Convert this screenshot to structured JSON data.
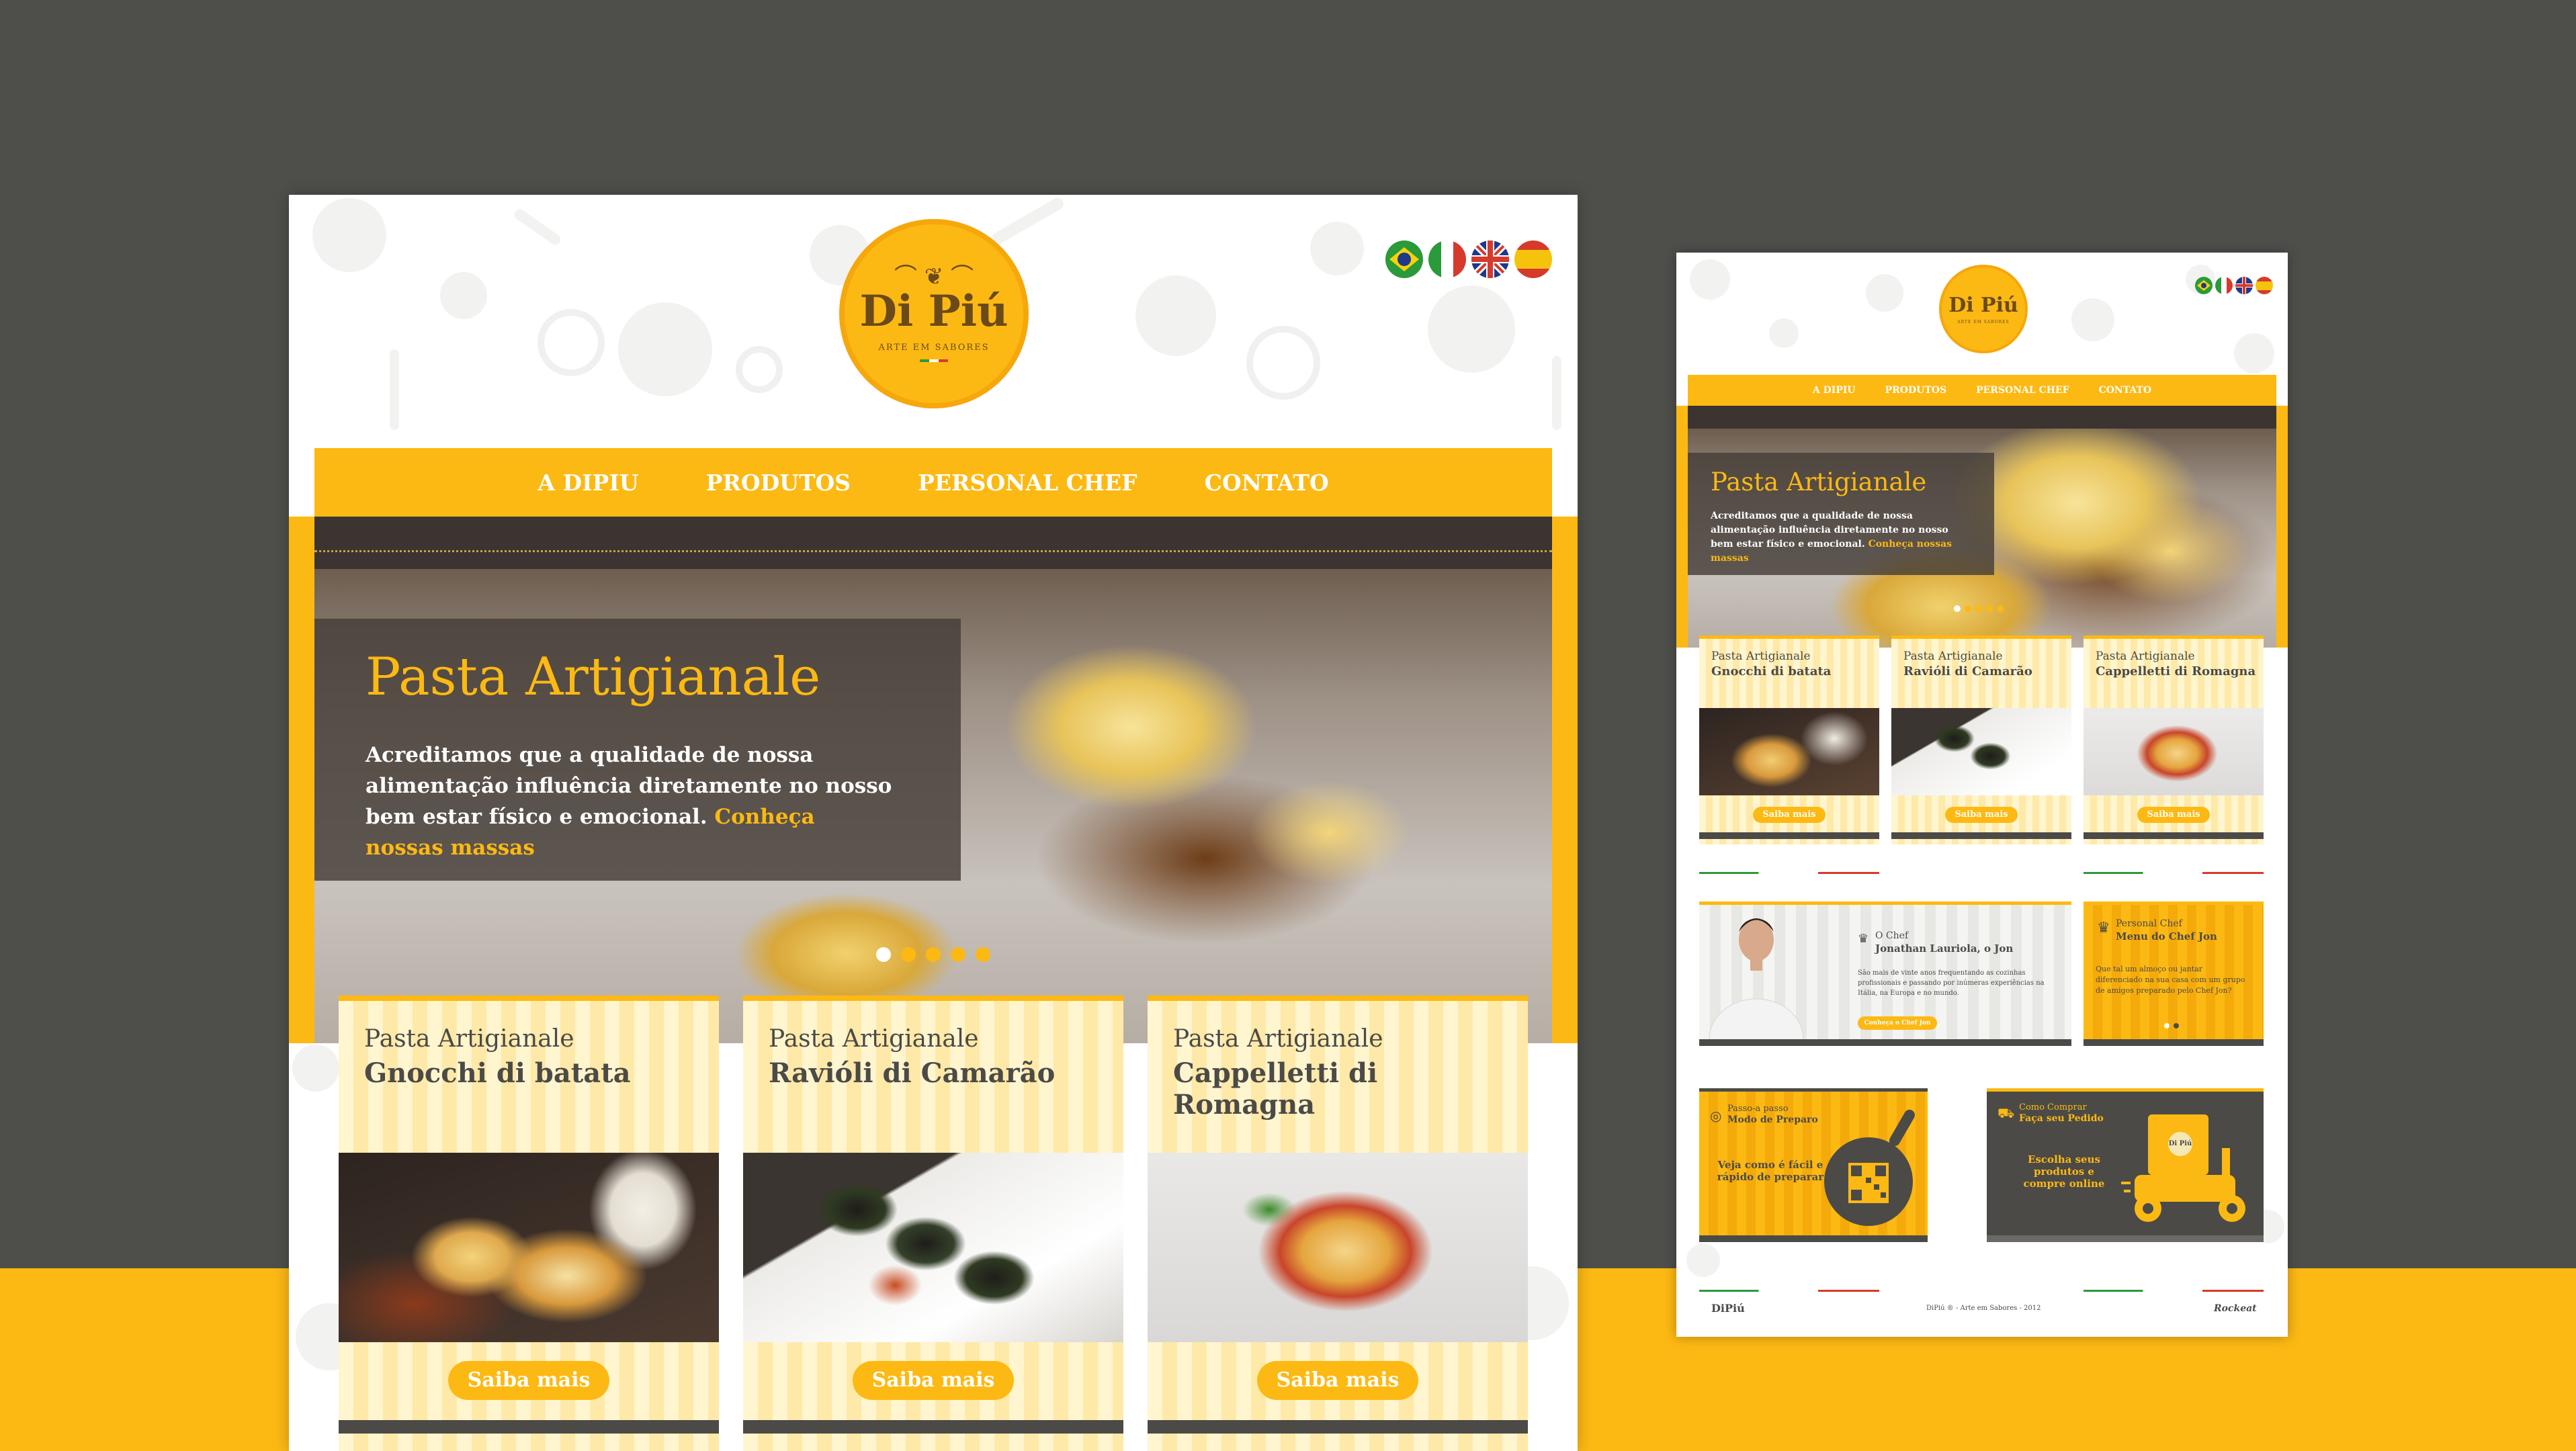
{
  "colors": {
    "background": "#4e4f4a",
    "accent": "#fdb913",
    "dark": "#4b4a47",
    "white": "#ffffff"
  },
  "logo": {
    "name": "Di Piú",
    "tagline": "ARTE EM SABORES"
  },
  "languages": [
    "Português",
    "Italiano",
    "English",
    "Español"
  ],
  "nav": {
    "items": [
      "A DIPIU",
      "PRODUTOS",
      "PERSONAL CHEF",
      "CONTATO"
    ]
  },
  "hero": {
    "title": "Pasta Artigianale",
    "text": "Acreditamos que a qualidade de nossa alimentação influência diretamente no nosso bem estar físico e emocional.",
    "link": "Conheça nossas massas",
    "slides": 5,
    "active_slide": 1
  },
  "products": [
    {
      "kicker": "Pasta Artigianale",
      "title": "Gnocchi di batata",
      "button": "Saiba mais"
    },
    {
      "kicker": "Pasta Artigianale",
      "title": "Ravióli di Camarão",
      "button": "Saiba mais"
    },
    {
      "kicker": "Pasta Artigianale",
      "title": "Cappelletti di Romagna",
      "button": "Saiba mais"
    }
  ],
  "chef": {
    "kicker": "O Chef",
    "name": "Jonathan Lauriola, o Jon",
    "bio": "São mais de vinte anos frequentando as cozinhas profissionais e passando por inúmeras experiências na Itália, na Europa e no mundo.",
    "button": "Conheça o Chef Jon"
  },
  "personal_chef": {
    "kicker": "Personal Chef",
    "title": "Menu do Chef Jon",
    "text": "Que tal um almoço ou jantar diferenciado na sua casa com um grupo de amigos preparado pelo Chef Jon?"
  },
  "prep": {
    "kicker": "Passo-a passo",
    "title": "Modo de Preparo",
    "text": "Veja como é fácil e rápido de preparar"
  },
  "order": {
    "kicker": "Como Comprar",
    "title": "Faça seu Pedido",
    "text": "Escolha seus produtos e compre online",
    "badge": "Di Piú"
  },
  "footer": {
    "brand": "DiPiú",
    "copyright": "DiPiú ® - Arte em Sabores - 2012",
    "credit": "Rockeat"
  }
}
